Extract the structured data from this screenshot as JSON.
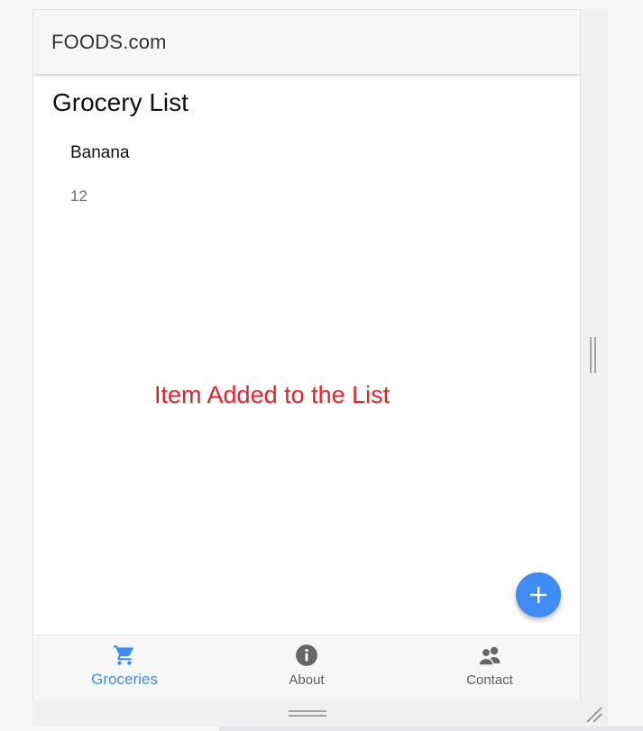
{
  "app": {
    "title": "FOODS.com"
  },
  "page": {
    "title": "Grocery List"
  },
  "list": [
    {
      "name": "Banana",
      "quantity": "12"
    }
  ],
  "toast": {
    "message": "Item Added to the List",
    "color": "#e8202a"
  },
  "fab": {
    "icon": "plus-icon",
    "color": "#3f8cf5"
  },
  "nav": {
    "items": [
      {
        "label": "Groceries",
        "icon": "shopping-cart-icon",
        "active": true
      },
      {
        "label": "About",
        "icon": "info-icon",
        "active": false
      },
      {
        "label": "Contact",
        "icon": "contacts-icon",
        "active": false
      }
    ],
    "active_color": "#3f8cf5"
  }
}
